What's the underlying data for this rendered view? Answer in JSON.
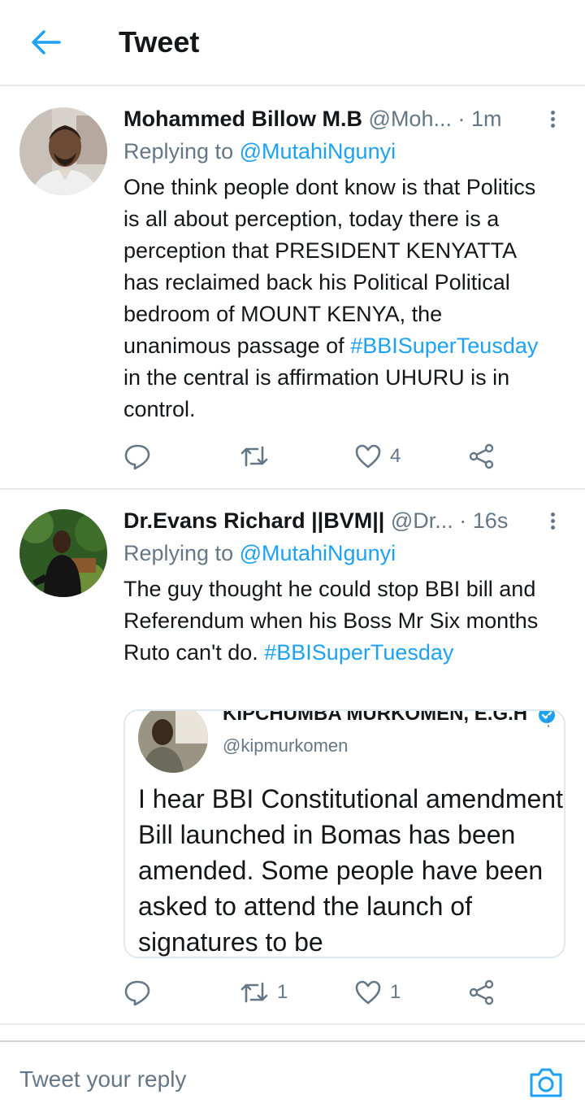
{
  "header": {
    "title": "Tweet",
    "back_icon": "arrow-left-icon"
  },
  "colors": {
    "accent": "#1da1f2",
    "text": "#14171a",
    "muted": "#657786",
    "divider": "#e6ecf0"
  },
  "tweets": [
    {
      "name": "Mohammed Billow M.B",
      "handle": "@Moh...",
      "dot": "·",
      "time": "1m",
      "replying_prefix": "Replying to ",
      "replying_to": "@MutahiNgunyi",
      "text_before": "One think people dont know is that Politics is all about perception, today there is a perception that PRESIDENT KENYATTA has reclaimed back his Political Political bedroom of MOUNT KENYA, the unanimous passage of ",
      "hashtag": "#BBISuperTeusday",
      "text_after": " in the central is affirmation UHURU is in control.",
      "replies": "",
      "retweets": "",
      "likes": "4"
    },
    {
      "name": "Dr.Evans Richard ||BVM||",
      "handle": "@Dr...",
      "dot": "·",
      "time": "16s",
      "replying_prefix": "Replying to ",
      "replying_to": "@MutahiNgunyi",
      "text_before": "The guy thought he could stop BBI bill and Referendum when his Boss Mr Six months Ruto can't do. ",
      "hashtag": "#BBISuperTuesday",
      "text_after": "",
      "replies": "",
      "retweets": "1",
      "likes": "1",
      "quote": {
        "name": "KIPCHUMBA MURKOMEN, E.G.H",
        "handle": "@kipmurkomen",
        "text": "I hear BBI Constitutional amendment Bill launched in Bomas has been amended. Some people  have been asked to attend the launch of signatures to be"
      }
    }
  ],
  "composer": {
    "placeholder": "Tweet your reply",
    "camera_icon": "camera-icon"
  }
}
